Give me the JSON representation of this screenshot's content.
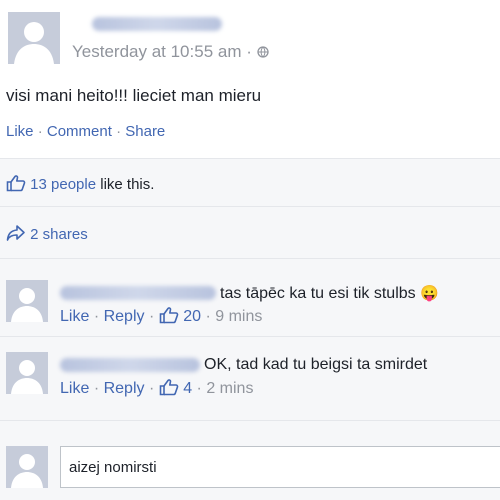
{
  "post": {
    "timestamp": "Yesterday at 10:55 am",
    "timestamp_suffix": "·",
    "privacy_icon": "globe-icon",
    "text": "visi mani heito!!! lieciet man mieru",
    "actions": {
      "like": "Like",
      "comment": "Comment",
      "share": "Share",
      "separator": "·"
    },
    "likes": {
      "count_text": "13 people",
      "suffix": "like this."
    },
    "shares": {
      "text": "2 shares"
    }
  },
  "comments": [
    {
      "text": "tas tāpēc ka tu esi tik stulbs",
      "emoji": "😛",
      "like": "Like",
      "reply": "Reply",
      "like_count": "20",
      "time": "9 mins",
      "separator": "·"
    },
    {
      "text": "OK, tad kad tu beigsi ta smirdet",
      "like": "Like",
      "reply": "Reply",
      "like_count": "4",
      "time": "2 mins",
      "separator": "·"
    }
  ],
  "reply_box": {
    "value": "aizej nomirsti"
  },
  "colors": {
    "link": "#4267b2",
    "muted": "#90949c",
    "band": "#f6f7f9",
    "avatar_bg": "#c6ccda"
  }
}
